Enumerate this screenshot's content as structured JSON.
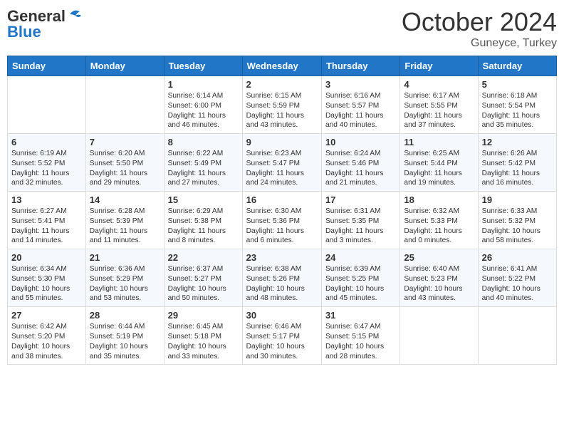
{
  "header": {
    "logo_general": "General",
    "logo_blue": "Blue",
    "month": "October 2024",
    "location": "Guneyce, Turkey"
  },
  "days_of_week": [
    "Sunday",
    "Monday",
    "Tuesday",
    "Wednesday",
    "Thursday",
    "Friday",
    "Saturday"
  ],
  "weeks": [
    [
      {
        "day": "",
        "sunrise": "",
        "sunset": "",
        "daylight": ""
      },
      {
        "day": "",
        "sunrise": "",
        "sunset": "",
        "daylight": ""
      },
      {
        "day": "1",
        "sunrise": "Sunrise: 6:14 AM",
        "sunset": "Sunset: 6:00 PM",
        "daylight": "Daylight: 11 hours and 46 minutes."
      },
      {
        "day": "2",
        "sunrise": "Sunrise: 6:15 AM",
        "sunset": "Sunset: 5:59 PM",
        "daylight": "Daylight: 11 hours and 43 minutes."
      },
      {
        "day": "3",
        "sunrise": "Sunrise: 6:16 AM",
        "sunset": "Sunset: 5:57 PM",
        "daylight": "Daylight: 11 hours and 40 minutes."
      },
      {
        "day": "4",
        "sunrise": "Sunrise: 6:17 AM",
        "sunset": "Sunset: 5:55 PM",
        "daylight": "Daylight: 11 hours and 37 minutes."
      },
      {
        "day": "5",
        "sunrise": "Sunrise: 6:18 AM",
        "sunset": "Sunset: 5:54 PM",
        "daylight": "Daylight: 11 hours and 35 minutes."
      }
    ],
    [
      {
        "day": "6",
        "sunrise": "Sunrise: 6:19 AM",
        "sunset": "Sunset: 5:52 PM",
        "daylight": "Daylight: 11 hours and 32 minutes."
      },
      {
        "day": "7",
        "sunrise": "Sunrise: 6:20 AM",
        "sunset": "Sunset: 5:50 PM",
        "daylight": "Daylight: 11 hours and 29 minutes."
      },
      {
        "day": "8",
        "sunrise": "Sunrise: 6:22 AM",
        "sunset": "Sunset: 5:49 PM",
        "daylight": "Daylight: 11 hours and 27 minutes."
      },
      {
        "day": "9",
        "sunrise": "Sunrise: 6:23 AM",
        "sunset": "Sunset: 5:47 PM",
        "daylight": "Daylight: 11 hours and 24 minutes."
      },
      {
        "day": "10",
        "sunrise": "Sunrise: 6:24 AM",
        "sunset": "Sunset: 5:46 PM",
        "daylight": "Daylight: 11 hours and 21 minutes."
      },
      {
        "day": "11",
        "sunrise": "Sunrise: 6:25 AM",
        "sunset": "Sunset: 5:44 PM",
        "daylight": "Daylight: 11 hours and 19 minutes."
      },
      {
        "day": "12",
        "sunrise": "Sunrise: 6:26 AM",
        "sunset": "Sunset: 5:42 PM",
        "daylight": "Daylight: 11 hours and 16 minutes."
      }
    ],
    [
      {
        "day": "13",
        "sunrise": "Sunrise: 6:27 AM",
        "sunset": "Sunset: 5:41 PM",
        "daylight": "Daylight: 11 hours and 14 minutes."
      },
      {
        "day": "14",
        "sunrise": "Sunrise: 6:28 AM",
        "sunset": "Sunset: 5:39 PM",
        "daylight": "Daylight: 11 hours and 11 minutes."
      },
      {
        "day": "15",
        "sunrise": "Sunrise: 6:29 AM",
        "sunset": "Sunset: 5:38 PM",
        "daylight": "Daylight: 11 hours and 8 minutes."
      },
      {
        "day": "16",
        "sunrise": "Sunrise: 6:30 AM",
        "sunset": "Sunset: 5:36 PM",
        "daylight": "Daylight: 11 hours and 6 minutes."
      },
      {
        "day": "17",
        "sunrise": "Sunrise: 6:31 AM",
        "sunset": "Sunset: 5:35 PM",
        "daylight": "Daylight: 11 hours and 3 minutes."
      },
      {
        "day": "18",
        "sunrise": "Sunrise: 6:32 AM",
        "sunset": "Sunset: 5:33 PM",
        "daylight": "Daylight: 11 hours and 0 minutes."
      },
      {
        "day": "19",
        "sunrise": "Sunrise: 6:33 AM",
        "sunset": "Sunset: 5:32 PM",
        "daylight": "Daylight: 10 hours and 58 minutes."
      }
    ],
    [
      {
        "day": "20",
        "sunrise": "Sunrise: 6:34 AM",
        "sunset": "Sunset: 5:30 PM",
        "daylight": "Daylight: 10 hours and 55 minutes."
      },
      {
        "day": "21",
        "sunrise": "Sunrise: 6:36 AM",
        "sunset": "Sunset: 5:29 PM",
        "daylight": "Daylight: 10 hours and 53 minutes."
      },
      {
        "day": "22",
        "sunrise": "Sunrise: 6:37 AM",
        "sunset": "Sunset: 5:27 PM",
        "daylight": "Daylight: 10 hours and 50 minutes."
      },
      {
        "day": "23",
        "sunrise": "Sunrise: 6:38 AM",
        "sunset": "Sunset: 5:26 PM",
        "daylight": "Daylight: 10 hours and 48 minutes."
      },
      {
        "day": "24",
        "sunrise": "Sunrise: 6:39 AM",
        "sunset": "Sunset: 5:25 PM",
        "daylight": "Daylight: 10 hours and 45 minutes."
      },
      {
        "day": "25",
        "sunrise": "Sunrise: 6:40 AM",
        "sunset": "Sunset: 5:23 PM",
        "daylight": "Daylight: 10 hours and 43 minutes."
      },
      {
        "day": "26",
        "sunrise": "Sunrise: 6:41 AM",
        "sunset": "Sunset: 5:22 PM",
        "daylight": "Daylight: 10 hours and 40 minutes."
      }
    ],
    [
      {
        "day": "27",
        "sunrise": "Sunrise: 6:42 AM",
        "sunset": "Sunset: 5:20 PM",
        "daylight": "Daylight: 10 hours and 38 minutes."
      },
      {
        "day": "28",
        "sunrise": "Sunrise: 6:44 AM",
        "sunset": "Sunset: 5:19 PM",
        "daylight": "Daylight: 10 hours and 35 minutes."
      },
      {
        "day": "29",
        "sunrise": "Sunrise: 6:45 AM",
        "sunset": "Sunset: 5:18 PM",
        "daylight": "Daylight: 10 hours and 33 minutes."
      },
      {
        "day": "30",
        "sunrise": "Sunrise: 6:46 AM",
        "sunset": "Sunset: 5:17 PM",
        "daylight": "Daylight: 10 hours and 30 minutes."
      },
      {
        "day": "31",
        "sunrise": "Sunrise: 6:47 AM",
        "sunset": "Sunset: 5:15 PM",
        "daylight": "Daylight: 10 hours and 28 minutes."
      },
      {
        "day": "",
        "sunrise": "",
        "sunset": "",
        "daylight": ""
      },
      {
        "day": "",
        "sunrise": "",
        "sunset": "",
        "daylight": ""
      }
    ]
  ]
}
